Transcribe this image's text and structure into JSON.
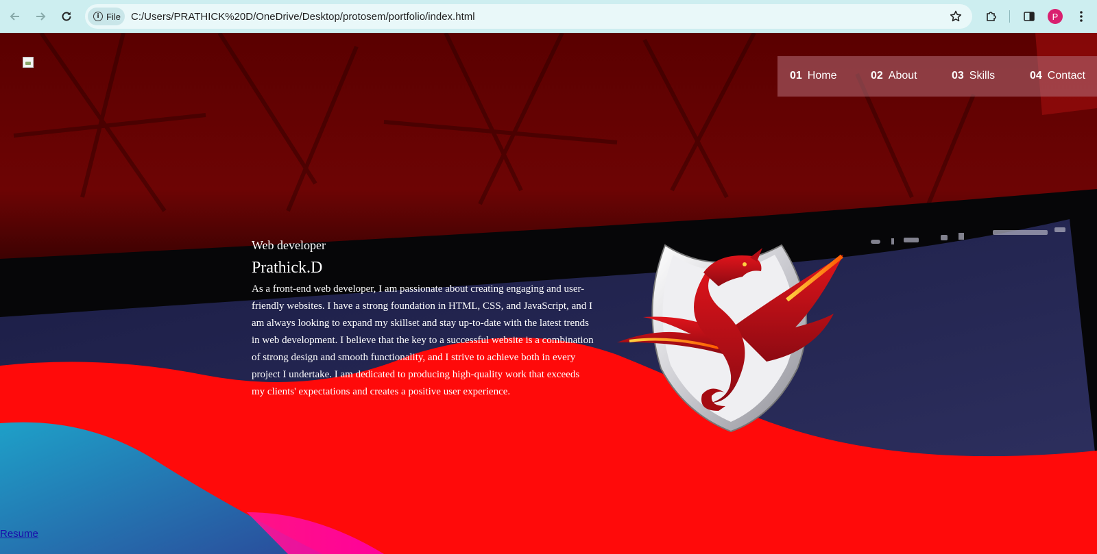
{
  "browser": {
    "file_chip_label": "File",
    "url": "C:/Users/PRATHICK%20D/OneDrive/Desktop/protosem/portfolio/index.html",
    "profile_initial": "P"
  },
  "nav": {
    "items": [
      {
        "num": "01",
        "label": "Home"
      },
      {
        "num": "02",
        "label": "About"
      },
      {
        "num": "03",
        "label": "Skills"
      },
      {
        "num": "04",
        "label": "Contact"
      }
    ]
  },
  "hero": {
    "role": "Web developer",
    "name": "Prathick.D",
    "bio": "As a front-end web developer, I am passionate about creating engaging and user-friendly websites. I have a strong foundation in HTML, CSS, and JavaScript, and I am always looking to expand my skillset and stay up-to-date with the latest trends in web development. I believe that the key to a successful website is a combination of strong design and smooth functionality, and I strive to achieve both in every project I undertake. I am dedicated to producing high-quality work that exceeds my clients' expectations and creates a positive user experience."
  },
  "footer": {
    "resume_link": "Resume"
  },
  "colors": {
    "chrome_bg": "#cdeef0",
    "nav_bg": "rgba(180,110,120,0.55)",
    "link": "#1a0dab"
  }
}
